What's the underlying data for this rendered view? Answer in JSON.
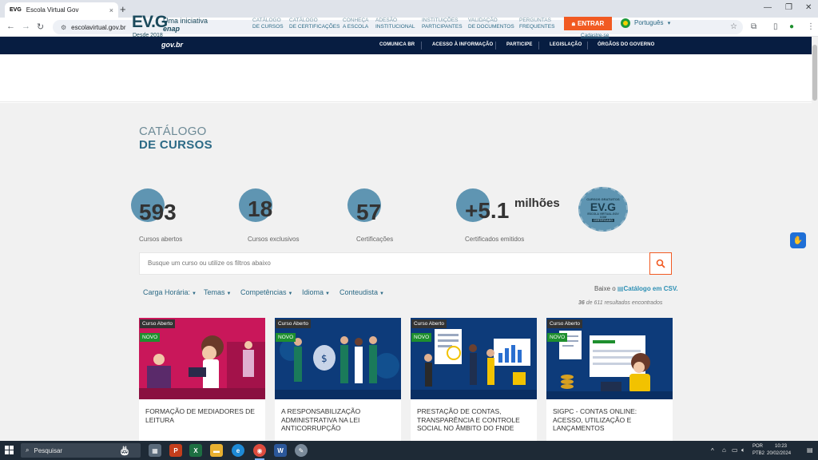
{
  "browser": {
    "tab_favicon": "EVG",
    "tab_title": "Escola Virtual Gov",
    "tab_close": "×",
    "new_tab": "+",
    "url": "escolavirtual.gov.br",
    "icons": [
      "back-arrow-icon",
      "forward-arrow-icon",
      "reload-icon",
      "star-icon",
      "extensions-icon",
      "sidepanel-icon",
      "profile-icon",
      "menu-icon"
    ]
  },
  "gov_bar": {
    "logo": "gov.br",
    "links": [
      "COMUNICA BR",
      "ACESSO À INFORMAÇÃO",
      "PARTICIPE",
      "LEGISLAÇÃO",
      "ÓRGÃOS DO GOVERNO"
    ]
  },
  "header": {
    "logo_mark": "EV.G",
    "logo_initiative": "Uma iniciativa",
    "logo_enap": "enap",
    "logo_since": "Desde 2018",
    "menu": [
      {
        "line1": "CATÁLOGO",
        "line2": "DE CURSOS"
      },
      {
        "line1": "CATÁLOGO",
        "line2": "DE CERTIFICAÇÕES"
      },
      {
        "line1": "CONHEÇA",
        "line2": "A ESCOLA"
      },
      {
        "line1": "ADESÃO",
        "line2": "INSTITUCIONAL"
      },
      {
        "line1": "INSTITUIÇÕES",
        "line2": "PARTICIPANTES"
      },
      {
        "line1": "VALIDAÇÃO",
        "line2": "DE DOCUMENTOS"
      },
      {
        "line1": "PERGUNTAS",
        "line2": "FREQUENTES"
      }
    ],
    "enter_button": "ENTRAR",
    "register_link": "Cadastre-se",
    "language": "Português"
  },
  "page": {
    "title_line1": "CATÁLOGO",
    "title_line2": "DE CURSOS",
    "stats": [
      {
        "value": "593",
        "label": "Cursos abertos"
      },
      {
        "value": "18",
        "label": "Cursos exclusivos"
      },
      {
        "value": "57",
        "label": "Certificações"
      },
      {
        "value": "+5.1",
        "label": "Certificados emitidos"
      }
    ],
    "millions": "milhões",
    "seal": {
      "top": "CURSOS GRATUITOS",
      "mark": "EV.G",
      "sub": "ESCOLA VIRTUAL.GOV",
      "bottom1": "COM",
      "bottom2": "CERTIFICADO"
    },
    "search_placeholder": "Busque um curso ou utilize os filtros abaixo",
    "filters": [
      "Carga Horária:",
      "Temas",
      "Competências",
      "Idioma",
      "Conteudista"
    ],
    "download_prefix": "Baixe o",
    "download_link": "Catálogo em CSV.",
    "results_count": "36",
    "results_text": "de 611 resultados encontrados"
  },
  "courses": [
    {
      "status": "Curso Aberto",
      "tag": "NOVO",
      "title": "FORMAÇÃO DE MEDIADORES DE LEITURA"
    },
    {
      "status": "Curso Aberto",
      "tag": "NOVO",
      "title": "A RESPONSABILIZAÇÃO ADMINISTRATIVA NA LEI ANTICORRUPÇÃO"
    },
    {
      "status": "Curso Aberto",
      "tag": "NOVO",
      "title": "PRESTAÇÃO DE CONTAS, TRANSPARÊNCIA E CONTROLE SOCIAL NO ÂMBITO DO FNDE"
    },
    {
      "status": "Curso Aberto",
      "tag": "NOVO",
      "title": "SIGPC - CONTAS ONLINE: ACESSO, UTILIZAÇÃO E LANÇAMENTOS"
    }
  ],
  "taskbar": {
    "search": "Pesquisar",
    "lang1": "POR",
    "lang2": "PTB2",
    "time": "10:23",
    "date": "20/02/2024"
  },
  "colors": {
    "gov_blue": "#071d41",
    "brand_teal": "#2c6a86",
    "accent_orange": "#f15a22",
    "stat_circle": "#5f95b2",
    "badge_new": "#1e8f2e"
  }
}
